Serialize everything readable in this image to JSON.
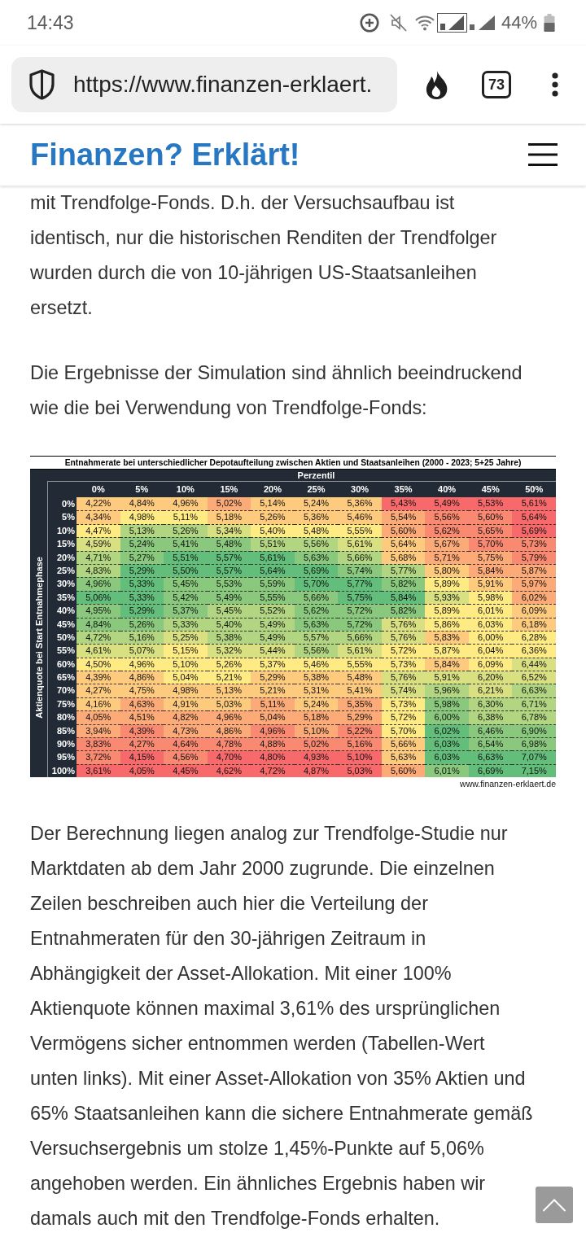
{
  "status_bar": {
    "time": "14:43",
    "battery": "44%"
  },
  "browser_toolbar": {
    "url": "https://www.finanzen-erklaert.",
    "tab_count": "73"
  },
  "site_header": {
    "logo": "Finanzen? Erklärt!"
  },
  "article": [
    {
      "kind": "paragraph",
      "lines": [
        "mit Trendfolge-Fonds. D.h. der Versuchsaufbau ist",
        "identisch, nur die historischen Renditen der Trendfolger",
        "wurden durch die von 10-jährigen US-Staatsanleihen",
        "ersetzt."
      ]
    },
    {
      "kind": "paragraph",
      "lines": [
        "Die Ergebnisse der Simulation sind ähnlich beeindruckend",
        "wie die bei Verwendung von Trendfolge-Fonds:"
      ]
    },
    {
      "kind": "heatmap_table",
      "title": "Entnahmerate bei unterschiedlicher Depotaufteilung zwischen Aktien und Staatsanleihen (2000 - 2023; 5+25 Jahre)",
      "column_group": "Perzentil",
      "row_axis_label": "Aktienquote bei Start Entnahmephase",
      "columns": [
        "0%",
        "5%",
        "10%",
        "15%",
        "20%",
        "25%",
        "30%",
        "35%",
        "40%",
        "45%",
        "50%"
      ],
      "rows": [
        {
          "label": "0%",
          "cells": [
            {
              "value": "4,22%",
              "color": "#fdca7e"
            },
            {
              "value": "4,84%",
              "color": "#fdca7e"
            },
            {
              "value": "4,96%",
              "color": "#fdca7e"
            },
            {
              "value": "5,02%",
              "color": "#fcaa78"
            },
            {
              "value": "5,14%",
              "color": "#fdca7e"
            },
            {
              "value": "5,24%",
              "color": "#fdca7e"
            },
            {
              "value": "5,36%",
              "color": "#fdca7e"
            },
            {
              "value": "5,43%",
              "color": "#f8696b"
            },
            {
              "value": "5,49%",
              "color": "#f8696b"
            },
            {
              "value": "5,53%",
              "color": "#f8696b"
            },
            {
              "value": "5,61%",
              "color": "#f8696b"
            }
          ]
        },
        {
          "label": "5%",
          "cells": [
            {
              "value": "4,34%",
              "color": "#fdca7e"
            },
            {
              "value": "4,98%",
              "color": "#ffeb84"
            },
            {
              "value": "5,11%",
              "color": "#ffeb84"
            },
            {
              "value": "5,18%",
              "color": "#fdca7e"
            },
            {
              "value": "5,26%",
              "color": "#fdca7e"
            },
            {
              "value": "5,36%",
              "color": "#fdca7e"
            },
            {
              "value": "5,46%",
              "color": "#fdca7e"
            },
            {
              "value": "5,54%",
              "color": "#fcaa78"
            },
            {
              "value": "5,56%",
              "color": "#fa8971"
            },
            {
              "value": "5,60%",
              "color": "#fa8971"
            },
            {
              "value": "5,64%",
              "color": "#f8696b"
            }
          ]
        },
        {
          "label": "10%",
          "cells": [
            {
              "value": "4,47%",
              "color": "#ffeb84"
            },
            {
              "value": "5,13%",
              "color": "#b1d580"
            },
            {
              "value": "5,26%",
              "color": "#b1d580"
            },
            {
              "value": "5,34%",
              "color": "#d8e082"
            },
            {
              "value": "5,40%",
              "color": "#ffeb84"
            },
            {
              "value": "5,48%",
              "color": "#ffeb84"
            },
            {
              "value": "5,55%",
              "color": "#ffeb84"
            },
            {
              "value": "5,60%",
              "color": "#fcaa78"
            },
            {
              "value": "5,62%",
              "color": "#fa8971"
            },
            {
              "value": "5,65%",
              "color": "#fa8971"
            },
            {
              "value": "5,69%",
              "color": "#f8696b"
            }
          ]
        },
        {
          "label": "15%",
          "cells": [
            {
              "value": "4,59%",
              "color": "#d8e082"
            },
            {
              "value": "5,24%",
              "color": "#8ac97d"
            },
            {
              "value": "5,41%",
              "color": "#8ac97d"
            },
            {
              "value": "5,48%",
              "color": "#8ac97d"
            },
            {
              "value": "5,51%",
              "color": "#b1d580"
            },
            {
              "value": "5,56%",
              "color": "#b1d580"
            },
            {
              "value": "5,61%",
              "color": "#d8e082"
            },
            {
              "value": "5,64%",
              "color": "#fdca7e"
            },
            {
              "value": "5,67%",
              "color": "#fcaa78"
            },
            {
              "value": "5,70%",
              "color": "#fa8971"
            },
            {
              "value": "5,73%",
              "color": "#fa8971"
            }
          ]
        },
        {
          "label": "20%",
          "cells": [
            {
              "value": "4,71%",
              "color": "#b1d580"
            },
            {
              "value": "5,27%",
              "color": "#8ac97d"
            },
            {
              "value": "5,51%",
              "color": "#63be7b"
            },
            {
              "value": "5,57%",
              "color": "#63be7b"
            },
            {
              "value": "5,61%",
              "color": "#63be7b"
            },
            {
              "value": "5,63%",
              "color": "#8ac97d"
            },
            {
              "value": "5,66%",
              "color": "#b1d580"
            },
            {
              "value": "5,68%",
              "color": "#fdca7e"
            },
            {
              "value": "5,71%",
              "color": "#fcaa78"
            },
            {
              "value": "5,75%",
              "color": "#fcaa78"
            },
            {
              "value": "5,79%",
              "color": "#fa8971"
            }
          ]
        },
        {
          "label": "25%",
          "cells": [
            {
              "value": "4,83%",
              "color": "#b1d580"
            },
            {
              "value": "5,29%",
              "color": "#63be7b"
            },
            {
              "value": "5,50%",
              "color": "#63be7b"
            },
            {
              "value": "5,57%",
              "color": "#63be7b"
            },
            {
              "value": "5,64%",
              "color": "#63be7b"
            },
            {
              "value": "5,69%",
              "color": "#63be7b"
            },
            {
              "value": "5,74%",
              "color": "#8ac97d"
            },
            {
              "value": "5,77%",
              "color": "#b1d580"
            },
            {
              "value": "5,80%",
              "color": "#fdca7e"
            },
            {
              "value": "5,84%",
              "color": "#fcaa78"
            },
            {
              "value": "5,87%",
              "color": "#fcaa78"
            }
          ]
        },
        {
          "label": "30%",
          "cells": [
            {
              "value": "4,96%",
              "color": "#8ac97d"
            },
            {
              "value": "5,33%",
              "color": "#63be7b"
            },
            {
              "value": "5,45%",
              "color": "#8ac97d"
            },
            {
              "value": "5,53%",
              "color": "#8ac97d"
            },
            {
              "value": "5,59%",
              "color": "#8ac97d"
            },
            {
              "value": "5,70%",
              "color": "#63be7b"
            },
            {
              "value": "5,77%",
              "color": "#63be7b"
            },
            {
              "value": "5,82%",
              "color": "#8ac97d"
            },
            {
              "value": "5,89%",
              "color": "#ffeb84"
            },
            {
              "value": "5,91%",
              "color": "#fdca7e"
            },
            {
              "value": "5,97%",
              "color": "#fcaa78"
            }
          ]
        },
        {
          "label": "35%",
          "cells": [
            {
              "value": "5,06%",
              "color": "#63be7b"
            },
            {
              "value": "5,33%",
              "color": "#63be7b"
            },
            {
              "value": "5,42%",
              "color": "#8ac97d"
            },
            {
              "value": "5,49%",
              "color": "#8ac97d"
            },
            {
              "value": "5,55%",
              "color": "#8ac97d"
            },
            {
              "value": "5,66%",
              "color": "#8ac97d"
            },
            {
              "value": "5,75%",
              "color": "#63be7b"
            },
            {
              "value": "5,84%",
              "color": "#63be7b"
            },
            {
              "value": "5,93%",
              "color": "#d8e082"
            },
            {
              "value": "5,98%",
              "color": "#ffeb84"
            },
            {
              "value": "6,02%",
              "color": "#fcaa78"
            }
          ]
        },
        {
          "label": "40%",
          "cells": [
            {
              "value": "4,95%",
              "color": "#8ac97d"
            },
            {
              "value": "5,29%",
              "color": "#63be7b"
            },
            {
              "value": "5,37%",
              "color": "#8ac97d"
            },
            {
              "value": "5,45%",
              "color": "#b1d580"
            },
            {
              "value": "5,52%",
              "color": "#b1d580"
            },
            {
              "value": "5,62%",
              "color": "#8ac97d"
            },
            {
              "value": "5,72%",
              "color": "#8ac97d"
            },
            {
              "value": "5,82%",
              "color": "#8ac97d"
            },
            {
              "value": "5,89%",
              "color": "#ffeb84"
            },
            {
              "value": "6,01%",
              "color": "#ffeb84"
            },
            {
              "value": "6,09%",
              "color": "#fdca7e"
            }
          ]
        },
        {
          "label": "45%",
          "cells": [
            {
              "value": "4,84%",
              "color": "#8ac97d"
            },
            {
              "value": "5,26%",
              "color": "#8ac97d"
            },
            {
              "value": "5,33%",
              "color": "#b1d580"
            },
            {
              "value": "5,40%",
              "color": "#b1d580"
            },
            {
              "value": "5,49%",
              "color": "#b1d580"
            },
            {
              "value": "5,63%",
              "color": "#8ac97d"
            },
            {
              "value": "5,72%",
              "color": "#8ac97d"
            },
            {
              "value": "5,76%",
              "color": "#d8e082"
            },
            {
              "value": "5,86%",
              "color": "#ffeb84"
            },
            {
              "value": "6,03%",
              "color": "#ffeb84"
            },
            {
              "value": "6,18%",
              "color": "#fdca7e"
            }
          ]
        },
        {
          "label": "50%",
          "cells": [
            {
              "value": "4,72%",
              "color": "#b1d580"
            },
            {
              "value": "5,16%",
              "color": "#b1d580"
            },
            {
              "value": "5,25%",
              "color": "#d8e082"
            },
            {
              "value": "5,38%",
              "color": "#b1d580"
            },
            {
              "value": "5,49%",
              "color": "#b1d580"
            },
            {
              "value": "5,57%",
              "color": "#b1d580"
            },
            {
              "value": "5,66%",
              "color": "#b1d580"
            },
            {
              "value": "5,76%",
              "color": "#d8e082"
            },
            {
              "value": "5,83%",
              "color": "#fdca7e"
            },
            {
              "value": "6,00%",
              "color": "#ffeb84"
            },
            {
              "value": "6,28%",
              "color": "#ffeb84"
            }
          ]
        },
        {
          "label": "55%",
          "cells": [
            {
              "value": "4,61%",
              "color": "#d8e082"
            },
            {
              "value": "5,07%",
              "color": "#d8e082"
            },
            {
              "value": "5,15%",
              "color": "#ffeb84"
            },
            {
              "value": "5,32%",
              "color": "#d8e082"
            },
            {
              "value": "5,44%",
              "color": "#d8e082"
            },
            {
              "value": "5,56%",
              "color": "#b1d580"
            },
            {
              "value": "5,61%",
              "color": "#d8e082"
            },
            {
              "value": "5,72%",
              "color": "#ffeb84"
            },
            {
              "value": "5,87%",
              "color": "#ffeb84"
            },
            {
              "value": "6,04%",
              "color": "#ffeb84"
            },
            {
              "value": "6,36%",
              "color": "#ffeb84"
            }
          ]
        },
        {
          "label": "60%",
          "cells": [
            {
              "value": "4,50%",
              "color": "#ffeb84"
            },
            {
              "value": "4,96%",
              "color": "#ffeb84"
            },
            {
              "value": "5,10%",
              "color": "#ffeb84"
            },
            {
              "value": "5,26%",
              "color": "#ffeb84"
            },
            {
              "value": "5,37%",
              "color": "#ffeb84"
            },
            {
              "value": "5,46%",
              "color": "#ffeb84"
            },
            {
              "value": "5,55%",
              "color": "#ffeb84"
            },
            {
              "value": "5,73%",
              "color": "#ffeb84"
            },
            {
              "value": "5,84%",
              "color": "#fdca7e"
            },
            {
              "value": "6,09%",
              "color": "#ffeb84"
            },
            {
              "value": "6,44%",
              "color": "#d8e082"
            }
          ]
        },
        {
          "label": "65%",
          "cells": [
            {
              "value": "4,39%",
              "color": "#fdca7e"
            },
            {
              "value": "4,86%",
              "color": "#fdca7e"
            },
            {
              "value": "5,04%",
              "color": "#ffeb84"
            },
            {
              "value": "5,21%",
              "color": "#ffeb84"
            },
            {
              "value": "5,29%",
              "color": "#fdca7e"
            },
            {
              "value": "5,38%",
              "color": "#fdca7e"
            },
            {
              "value": "5,48%",
              "color": "#fdca7e"
            },
            {
              "value": "5,76%",
              "color": "#d8e082"
            },
            {
              "value": "5,91%",
              "color": "#d8e082"
            },
            {
              "value": "6,20%",
              "color": "#d8e082"
            },
            {
              "value": "6,52%",
              "color": "#d8e082"
            }
          ]
        },
        {
          "label": "70%",
          "cells": [
            {
              "value": "4,27%",
              "color": "#fdca7e"
            },
            {
              "value": "4,75%",
              "color": "#fdca7e"
            },
            {
              "value": "4,98%",
              "color": "#fdca7e"
            },
            {
              "value": "5,13%",
              "color": "#fdca7e"
            },
            {
              "value": "5,21%",
              "color": "#fdca7e"
            },
            {
              "value": "5,31%",
              "color": "#fdca7e"
            },
            {
              "value": "5,41%",
              "color": "#fdca7e"
            },
            {
              "value": "5,74%",
              "color": "#d8e082"
            },
            {
              "value": "5,96%",
              "color": "#b1d580"
            },
            {
              "value": "6,21%",
              "color": "#d8e082"
            },
            {
              "value": "6,63%",
              "color": "#b1d580"
            }
          ]
        },
        {
          "label": "75%",
          "cells": [
            {
              "value": "4,16%",
              "color": "#fdca7e"
            },
            {
              "value": "4,63%",
              "color": "#fcaa78"
            },
            {
              "value": "4,91%",
              "color": "#fdca7e"
            },
            {
              "value": "5,03%",
              "color": "#fdca7e"
            },
            {
              "value": "5,11%",
              "color": "#fcaa78"
            },
            {
              "value": "5,24%",
              "color": "#fdca7e"
            },
            {
              "value": "5,35%",
              "color": "#fcaa78"
            },
            {
              "value": "5,73%",
              "color": "#ffeb84"
            },
            {
              "value": "5,98%",
              "color": "#8ac97d"
            },
            {
              "value": "6,30%",
              "color": "#b1d580"
            },
            {
              "value": "6,71%",
              "color": "#b1d580"
            }
          ]
        },
        {
          "label": "80%",
          "cells": [
            {
              "value": "4,05%",
              "color": "#fcaa78"
            },
            {
              "value": "4,51%",
              "color": "#fcaa78"
            },
            {
              "value": "4,82%",
              "color": "#fcaa78"
            },
            {
              "value": "4,96%",
              "color": "#fcaa78"
            },
            {
              "value": "5,04%",
              "color": "#fcaa78"
            },
            {
              "value": "5,18%",
              "color": "#fcaa78"
            },
            {
              "value": "5,29%",
              "color": "#fcaa78"
            },
            {
              "value": "5,72%",
              "color": "#ffeb84"
            },
            {
              "value": "6,00%",
              "color": "#8ac97d"
            },
            {
              "value": "6,38%",
              "color": "#b1d580"
            },
            {
              "value": "6,78%",
              "color": "#b1d580"
            }
          ]
        },
        {
          "label": "85%",
          "cells": [
            {
              "value": "3,94%",
              "color": "#fcaa78"
            },
            {
              "value": "4,39%",
              "color": "#fa8971"
            },
            {
              "value": "4,73%",
              "color": "#fcaa78"
            },
            {
              "value": "4,86%",
              "color": "#fcaa78"
            },
            {
              "value": "4,96%",
              "color": "#fa8971"
            },
            {
              "value": "5,10%",
              "color": "#fcaa78"
            },
            {
              "value": "5,22%",
              "color": "#fa8971"
            },
            {
              "value": "5,70%",
              "color": "#ffeb84"
            },
            {
              "value": "6,02%",
              "color": "#63be7b"
            },
            {
              "value": "6,46%",
              "color": "#8ac97d"
            },
            {
              "value": "6,90%",
              "color": "#8ac97d"
            }
          ]
        },
        {
          "label": "90%",
          "cells": [
            {
              "value": "3,83%",
              "color": "#fa8971"
            },
            {
              "value": "4,27%",
              "color": "#fa8971"
            },
            {
              "value": "4,64%",
              "color": "#fa8971"
            },
            {
              "value": "4,78%",
              "color": "#fa8971"
            },
            {
              "value": "4,88%",
              "color": "#fa8971"
            },
            {
              "value": "5,02%",
              "color": "#fa8971"
            },
            {
              "value": "5,16%",
              "color": "#fa8971"
            },
            {
              "value": "5,66%",
              "color": "#fdca7e"
            },
            {
              "value": "6,03%",
              "color": "#63be7b"
            },
            {
              "value": "6,54%",
              "color": "#8ac97d"
            },
            {
              "value": "6,98%",
              "color": "#8ac97d"
            }
          ]
        },
        {
          "label": "95%",
          "cells": [
            {
              "value": "3,72%",
              "color": "#fa8971"
            },
            {
              "value": "4,15%",
              "color": "#f8696b"
            },
            {
              "value": "4,56%",
              "color": "#fa8971"
            },
            {
              "value": "4,70%",
              "color": "#f8696b"
            },
            {
              "value": "4,80%",
              "color": "#f8696b"
            },
            {
              "value": "4,93%",
              "color": "#f8696b"
            },
            {
              "value": "5,10%",
              "color": "#f8696b"
            },
            {
              "value": "5,63%",
              "color": "#fdca7e"
            },
            {
              "value": "6,03%",
              "color": "#63be7b"
            },
            {
              "value": "6,63%",
              "color": "#63be7b"
            },
            {
              "value": "7,07%",
              "color": "#63be7b"
            }
          ]
        },
        {
          "label": "100%",
          "cells": [
            {
              "value": "3,61%",
              "color": "#f8696b"
            },
            {
              "value": "4,05%",
              "color": "#f8696b"
            },
            {
              "value": "4,45%",
              "color": "#f8696b"
            },
            {
              "value": "4,62%",
              "color": "#f8696b"
            },
            {
              "value": "4,72%",
              "color": "#f8696b"
            },
            {
              "value": "4,87%",
              "color": "#f8696b"
            },
            {
              "value": "5,03%",
              "color": "#f8696b"
            },
            {
              "value": "5,60%",
              "color": "#fcaa78"
            },
            {
              "value": "6,01%",
              "color": "#8ac97d"
            },
            {
              "value": "6,69%",
              "color": "#63be7b"
            },
            {
              "value": "7,15%",
              "color": "#63be7b"
            }
          ]
        }
      ],
      "credit": "www.finanzen-erklaert.de"
    },
    {
      "kind": "paragraph",
      "lines": [
        "Der Berechnung liegen analog zur Trendfolge-Studie nur",
        "Marktdaten ab dem Jahr 2000 zugrunde. Die einzelnen",
        "Zeilen beschreiben auch hier die Verteilung der",
        "Entnahmeraten für den 30-jährigen Zeitraum in",
        "Abhängigkeit der Asset-Allokation. Mit einer 100%",
        "Aktienquote können maximal 3,61% des ursprünglichen",
        "Vermögens sicher entnommen werden (Tabellen-Wert",
        "unten links). Mit einer Asset-Allokation von 35% Aktien und",
        "65% Staatsanleihen kann die sichere Entnahmerate gemäß",
        "Versuchsergebnis um stolze 1,45%-Punkte auf 5,06%",
        "angehoben werden. Ein ähnliches Ergebnis haben wir",
        "damals auch mit den Trendfolge-Fonds erhalten."
      ]
    }
  ]
}
